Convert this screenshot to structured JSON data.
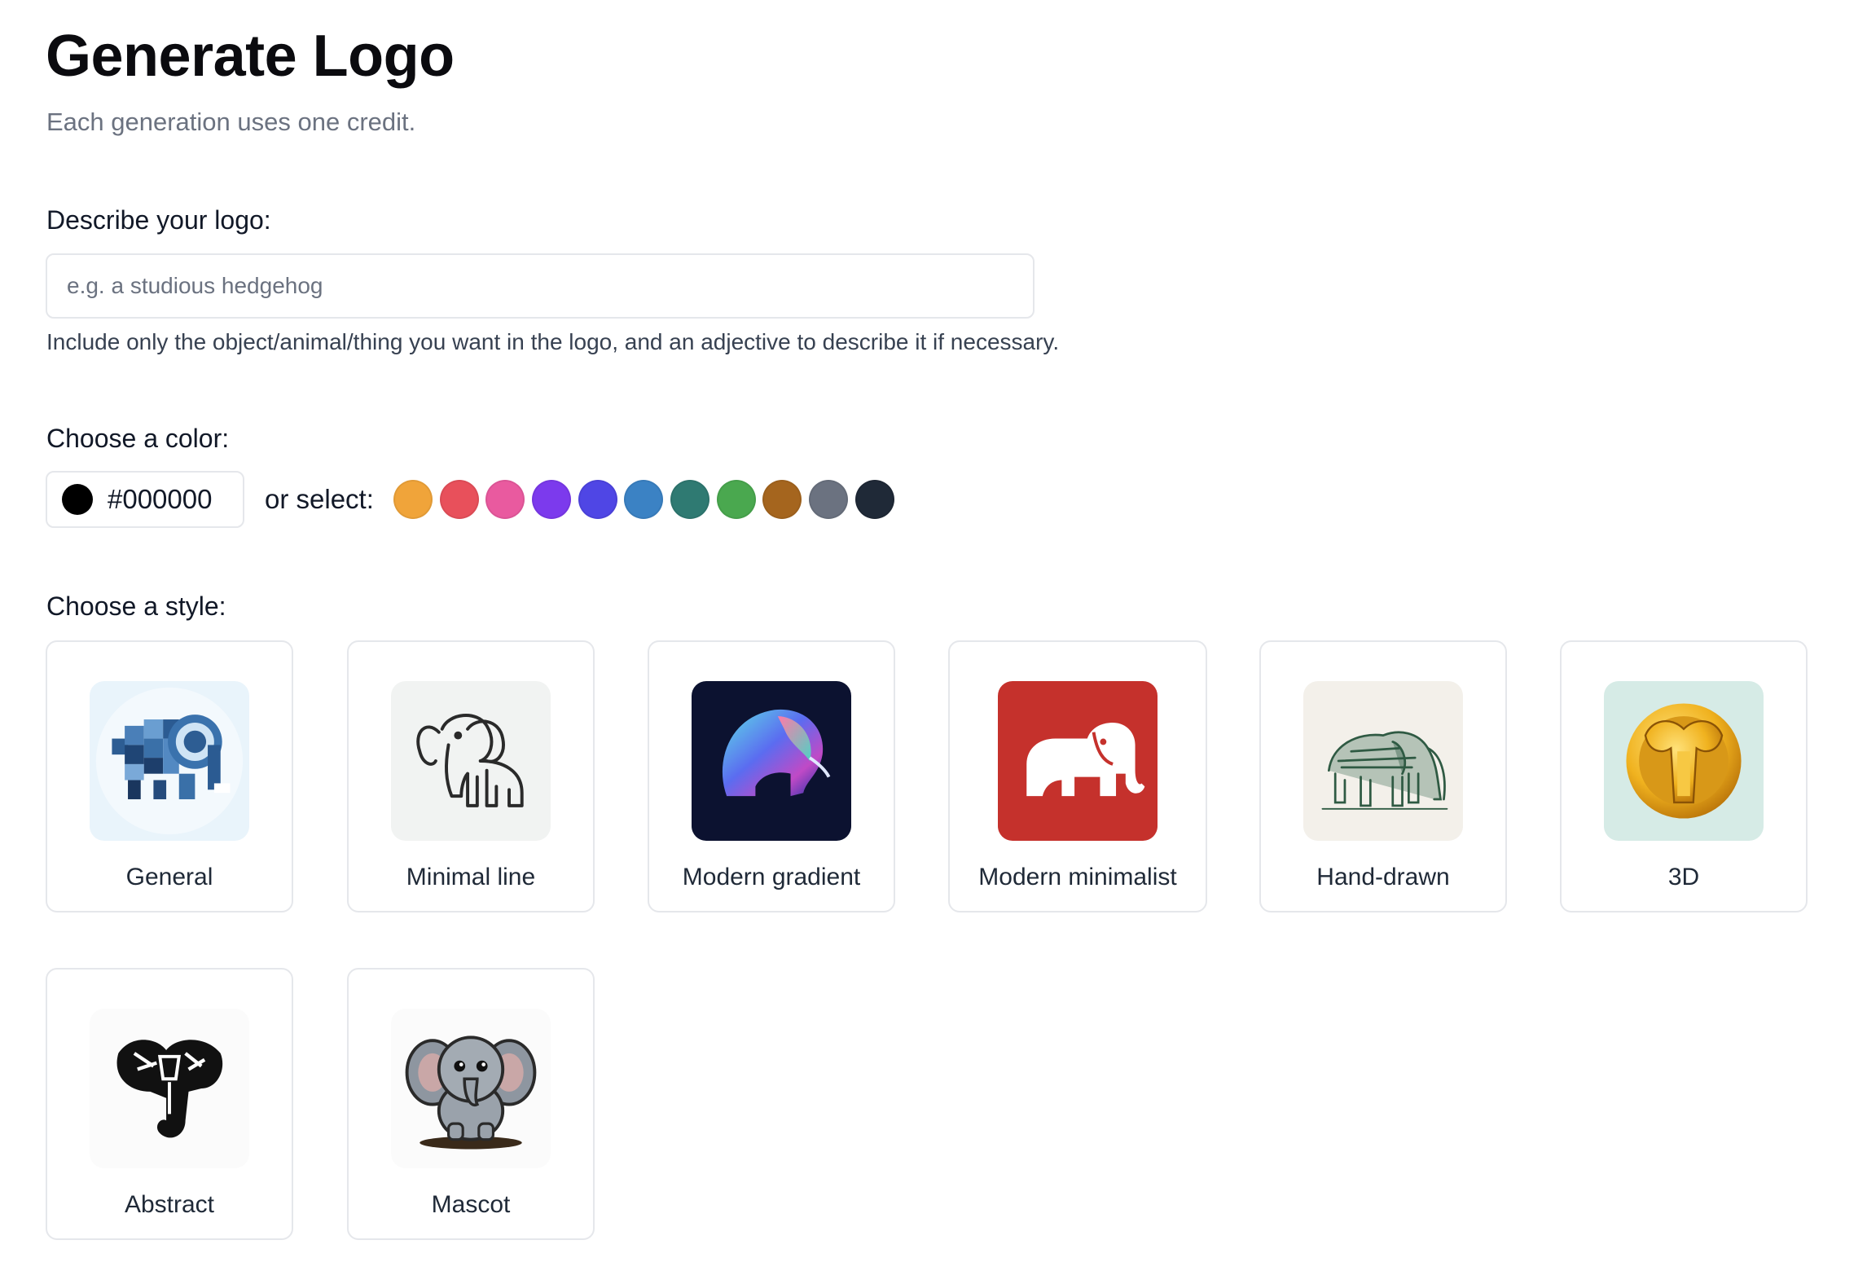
{
  "header": {
    "title": "Generate Logo",
    "subtitle": "Each generation uses one credit."
  },
  "describe": {
    "label": "Describe your logo:",
    "placeholder": "e.g. a studious hedgehog",
    "value": "",
    "helper": "Include only the object/animal/thing you want in the logo, and an adjective to describe it if necessary."
  },
  "color": {
    "label": "Choose a color:",
    "current_hex": "#000000",
    "or_select_label": "or select:",
    "swatches": [
      "#f0a43a",
      "#e8505b",
      "#e95a9f",
      "#7c3aed",
      "#4f46e5",
      "#3b82c4",
      "#2f7a72",
      "#4aa84f",
      "#a5651e",
      "#6b7280",
      "#1f2937"
    ]
  },
  "style": {
    "label": "Choose a style:",
    "options": [
      {
        "label": "General",
        "icon": "pixel-elephant-icon"
      },
      {
        "label": "Minimal line",
        "icon": "line-elephant-icon"
      },
      {
        "label": "Modern gradient",
        "icon": "gradient-elephant-icon"
      },
      {
        "label": "Modern minimalist",
        "icon": "minimalist-elephant-icon"
      },
      {
        "label": "Hand-drawn",
        "icon": "sketch-elephant-icon"
      },
      {
        "label": "3D",
        "icon": "3d-elephant-icon"
      },
      {
        "label": "Abstract",
        "icon": "abstract-elephant-icon"
      },
      {
        "label": "Mascot",
        "icon": "mascot-elephant-icon"
      }
    ]
  }
}
